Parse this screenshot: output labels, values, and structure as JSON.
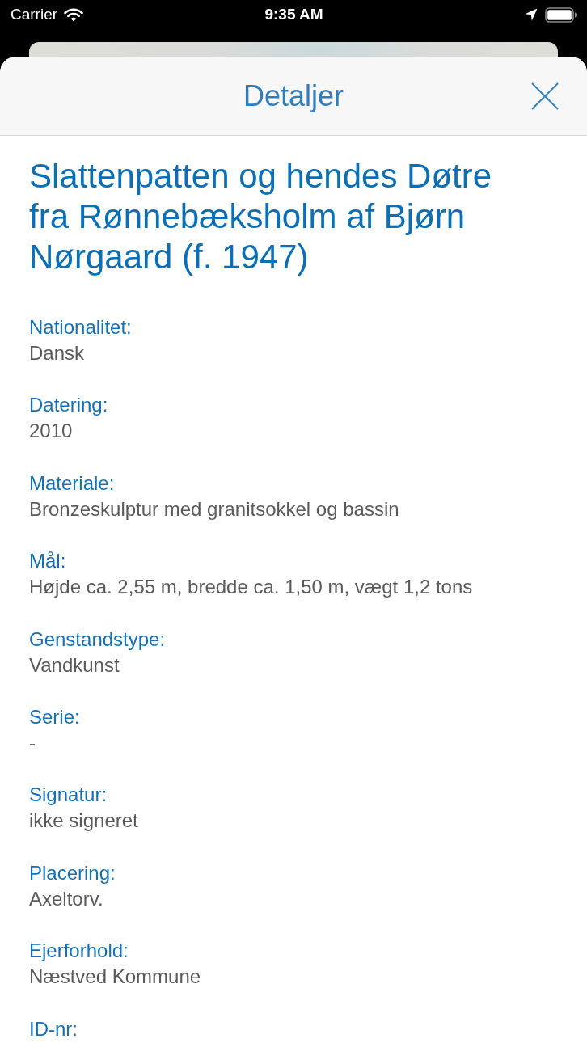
{
  "status_bar": {
    "carrier": "Carrier",
    "time": "9:35 AM"
  },
  "header": {
    "title": "Detaljer"
  },
  "artwork": {
    "title": "Slattenpatten og hendes Døtre fra Rønnebæksholm af Bjørn Nørgaard (f. 1947)"
  },
  "fields": [
    {
      "label": "Nationalitet:",
      "value": "Dansk"
    },
    {
      "label": "Datering:",
      "value": "2010"
    },
    {
      "label": "Materiale:",
      "value": "Bronzeskulptur med granitsokkel og bassin"
    },
    {
      "label": "Mål:",
      "value": "Højde ca. 2,55 m, bredde ca. 1,50 m, vægt 1,2 tons"
    },
    {
      "label": "Genstandstype:",
      "value": "Vandkunst"
    },
    {
      "label": "Serie:",
      "value": "-"
    },
    {
      "label": "Signatur:",
      "value": "ikke signeret"
    },
    {
      "label": "Placering:",
      "value": "Axeltorv."
    },
    {
      "label": "Ejerforhold:",
      "value": "Næstved Kommune"
    },
    {
      "label": "ID-nr:"
    }
  ]
}
